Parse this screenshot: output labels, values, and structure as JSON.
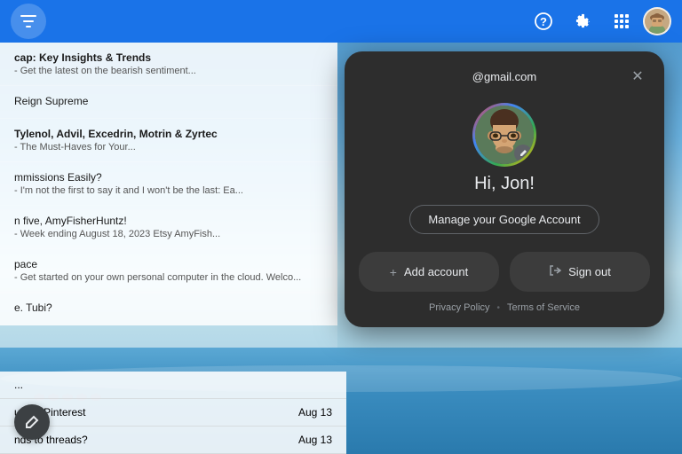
{
  "topbar": {
    "filter_icon": "⊞",
    "help_icon": "?",
    "settings_icon": "⚙",
    "grid_icon": "⠿",
    "avatar_icon": "👤"
  },
  "emails": [
    {
      "sender": "cap: Key Insights & Trends",
      "preview": " - Get the latest on the bearish sentiment...",
      "date": "",
      "unread": true
    },
    {
      "sender": "Reign Supreme",
      "preview": "",
      "date": "",
      "unread": false
    },
    {
      "sender": "Tylenol, Advil, Excedrin, Motrin & Zyrtec",
      "preview": " - The Must-Haves for Your...",
      "date": "",
      "unread": true
    },
    {
      "sender": "mmissions Easily?",
      "preview": " - I'm not the first to say it and I won't be the last: Ea...",
      "date": "",
      "unread": false
    },
    {
      "sender": "n five, AmyFisherHuntz!",
      "preview": " - Week ending August 18, 2023 Etsy AmyFish...",
      "date": "",
      "unread": false
    },
    {
      "sender": "pace",
      "preview": " - Get started on your own personal computer in the cloud. Welco...",
      "date": "",
      "unread": false
    },
    {
      "sender": "e. Tubi?",
      "preview": "",
      "date": "",
      "unread": false
    }
  ],
  "bottom_emails": [
    {
      "sender": "...",
      "date": "",
      "unread": false
    },
    {
      "sender": "uff on Pinterest",
      "date": "Aug 13",
      "unread": false
    },
    {
      "sender": "nds to threads?",
      "date": "Aug 13",
      "unread": false
    }
  ],
  "popup": {
    "email": "@gmail.com",
    "greeting": "Hi, Jon!",
    "manage_label": "Manage your Google Account",
    "add_account_label": "Add account",
    "sign_out_label": "Sign out",
    "privacy_policy_label": "Privacy Policy",
    "terms_label": "Terms of Service",
    "dot_separator": "•",
    "close_icon": "✕",
    "add_icon": "+",
    "signout_icon": "→",
    "edit_icon": "✎"
  }
}
